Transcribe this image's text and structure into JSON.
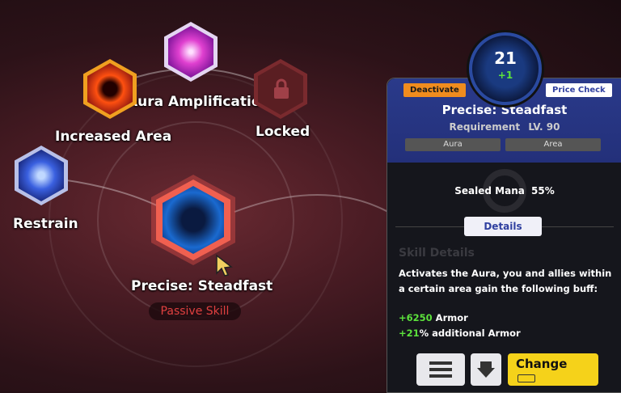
{
  "skill_tree": {
    "nodes": {
      "aura_amplification": {
        "label": "Aura Amplification"
      },
      "increased_area": {
        "label": "Increased Area"
      },
      "locked": {
        "label": "Locked"
      },
      "restrain": {
        "label": "Restrain"
      },
      "precise_steadfast": {
        "label": "Precise: Steadfast",
        "badge": "Passive Skill"
      }
    }
  },
  "detail_panel": {
    "level_number": "21",
    "level_bonus": "+1",
    "deactivate_label": "Deactivate",
    "price_check_label": "Price Check",
    "title": "Precise: Steadfast",
    "requirement_label": "Requirement",
    "requirement_value": "LV. 90",
    "tags": [
      "Aura",
      "Area"
    ],
    "sealed_mana_label": "Sealed Mana",
    "sealed_mana_value": "55%",
    "details_button": "Details",
    "skill_details_heading": "Skill Details",
    "description": "Activates the Aura, you and allies within a certain area gain the following buff:",
    "buffs": [
      {
        "value": "+6250",
        "text": "Armor"
      },
      {
        "value": "+21",
        "text": "% additional Armor"
      }
    ],
    "change_label": "Change"
  },
  "colors": {
    "accent_orange": "#f08c1e",
    "buff_green": "#5ce23c",
    "change_yellow": "#f5d21a",
    "passive_red": "#e04040"
  }
}
